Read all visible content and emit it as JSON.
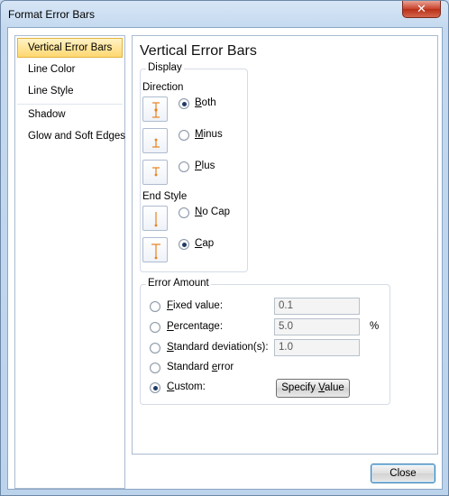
{
  "window": {
    "title": "Format Error Bars",
    "close_glyph": "✕"
  },
  "nav": {
    "items": [
      {
        "label": "Vertical Error Bars"
      },
      {
        "label": "Line Color"
      },
      {
        "label": "Line Style"
      },
      {
        "label": "Shadow"
      },
      {
        "label": "Glow and Soft Edges"
      }
    ],
    "active_index": 0
  },
  "panel": {
    "heading": "Vertical Error Bars",
    "display": {
      "group_label": "Display",
      "direction_label": "Direction",
      "direction_options": [
        {
          "label_u": "B",
          "label_rest": "oth",
          "checked": true,
          "icon": "error-bar-both-icon"
        },
        {
          "label_u": "M",
          "label_rest": "inus",
          "checked": false,
          "icon": "error-bar-minus-icon"
        },
        {
          "label_u": "P",
          "label_rest": "lus",
          "checked": false,
          "icon": "error-bar-plus-icon"
        }
      ],
      "end_style_label": "End Style",
      "end_style_options": [
        {
          "label_u": "N",
          "label_rest": "o Cap",
          "checked": false,
          "icon": "error-bar-no-cap-icon"
        },
        {
          "label_u": "C",
          "label_rest": "ap",
          "checked": true,
          "icon": "error-bar-cap-icon"
        }
      ]
    },
    "error_amount": {
      "group_label": "Error Amount",
      "options": [
        {
          "label_u": "F",
          "label_rest": "ixed value:",
          "checked": false,
          "field": "0.1"
        },
        {
          "label_u": "P",
          "label_rest": "ercentage:",
          "checked": false,
          "field": "5.0",
          "suffix": "%"
        },
        {
          "label_u": "S",
          "label_rest": "tandard deviation(s):",
          "checked": false,
          "field": "1.0"
        },
        {
          "label_pre": "Standard ",
          "label_u": "e",
          "label_rest": "rror",
          "checked": false
        },
        {
          "label_u": "C",
          "label_rest": "ustom:",
          "checked": true
        }
      ],
      "specify_button": {
        "label_pre": "Specify ",
        "label_u": "V",
        "label_rest": "alue"
      }
    }
  },
  "footer": {
    "close_label": "Close"
  },
  "colors": {
    "accent_orange": "#e8821e",
    "selection_gold": "#ffd770"
  }
}
